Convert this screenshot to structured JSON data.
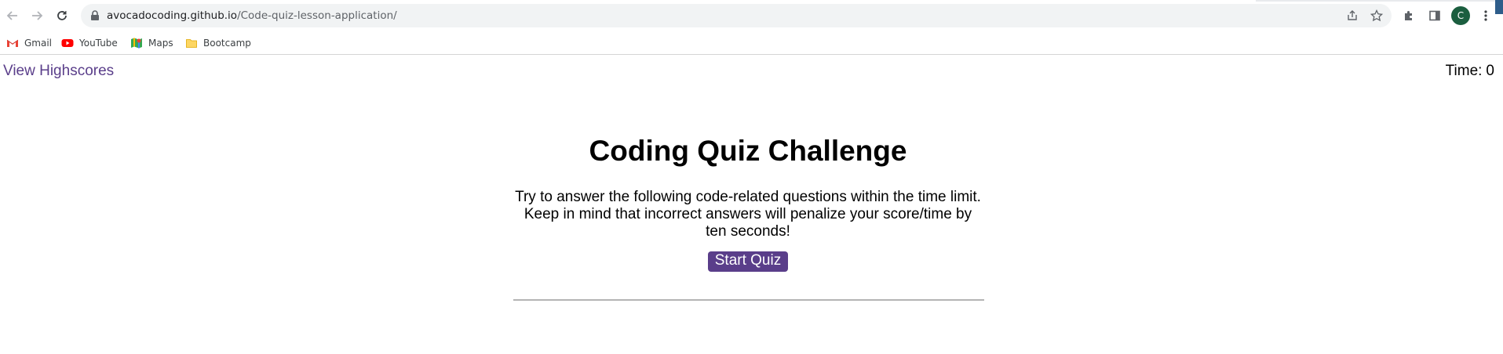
{
  "browser": {
    "url_host": "avocadocoding.github.io",
    "url_path": "/Code-quiz-lesson-application/",
    "profile_initial": "C",
    "bookmarks": [
      {
        "label": "Gmail",
        "icon": "gmail-icon"
      },
      {
        "label": "YouTube",
        "icon": "youtube-icon"
      },
      {
        "label": "Maps",
        "icon": "maps-icon"
      },
      {
        "label": "Bootcamp",
        "icon": "folder-icon"
      }
    ]
  },
  "page": {
    "highscores_link": "View Highscores",
    "timer_label": "Time:",
    "timer_value": "0",
    "title": "Coding Quiz Challenge",
    "description": "Try to answer the following code-related questions within the time limit. Keep in mind that incorrect answers will penalize your score/time by ten seconds!",
    "start_button": "Start Quiz"
  },
  "colors": {
    "accent": "#5a3e8a",
    "avatar": "#1b5e3f"
  }
}
